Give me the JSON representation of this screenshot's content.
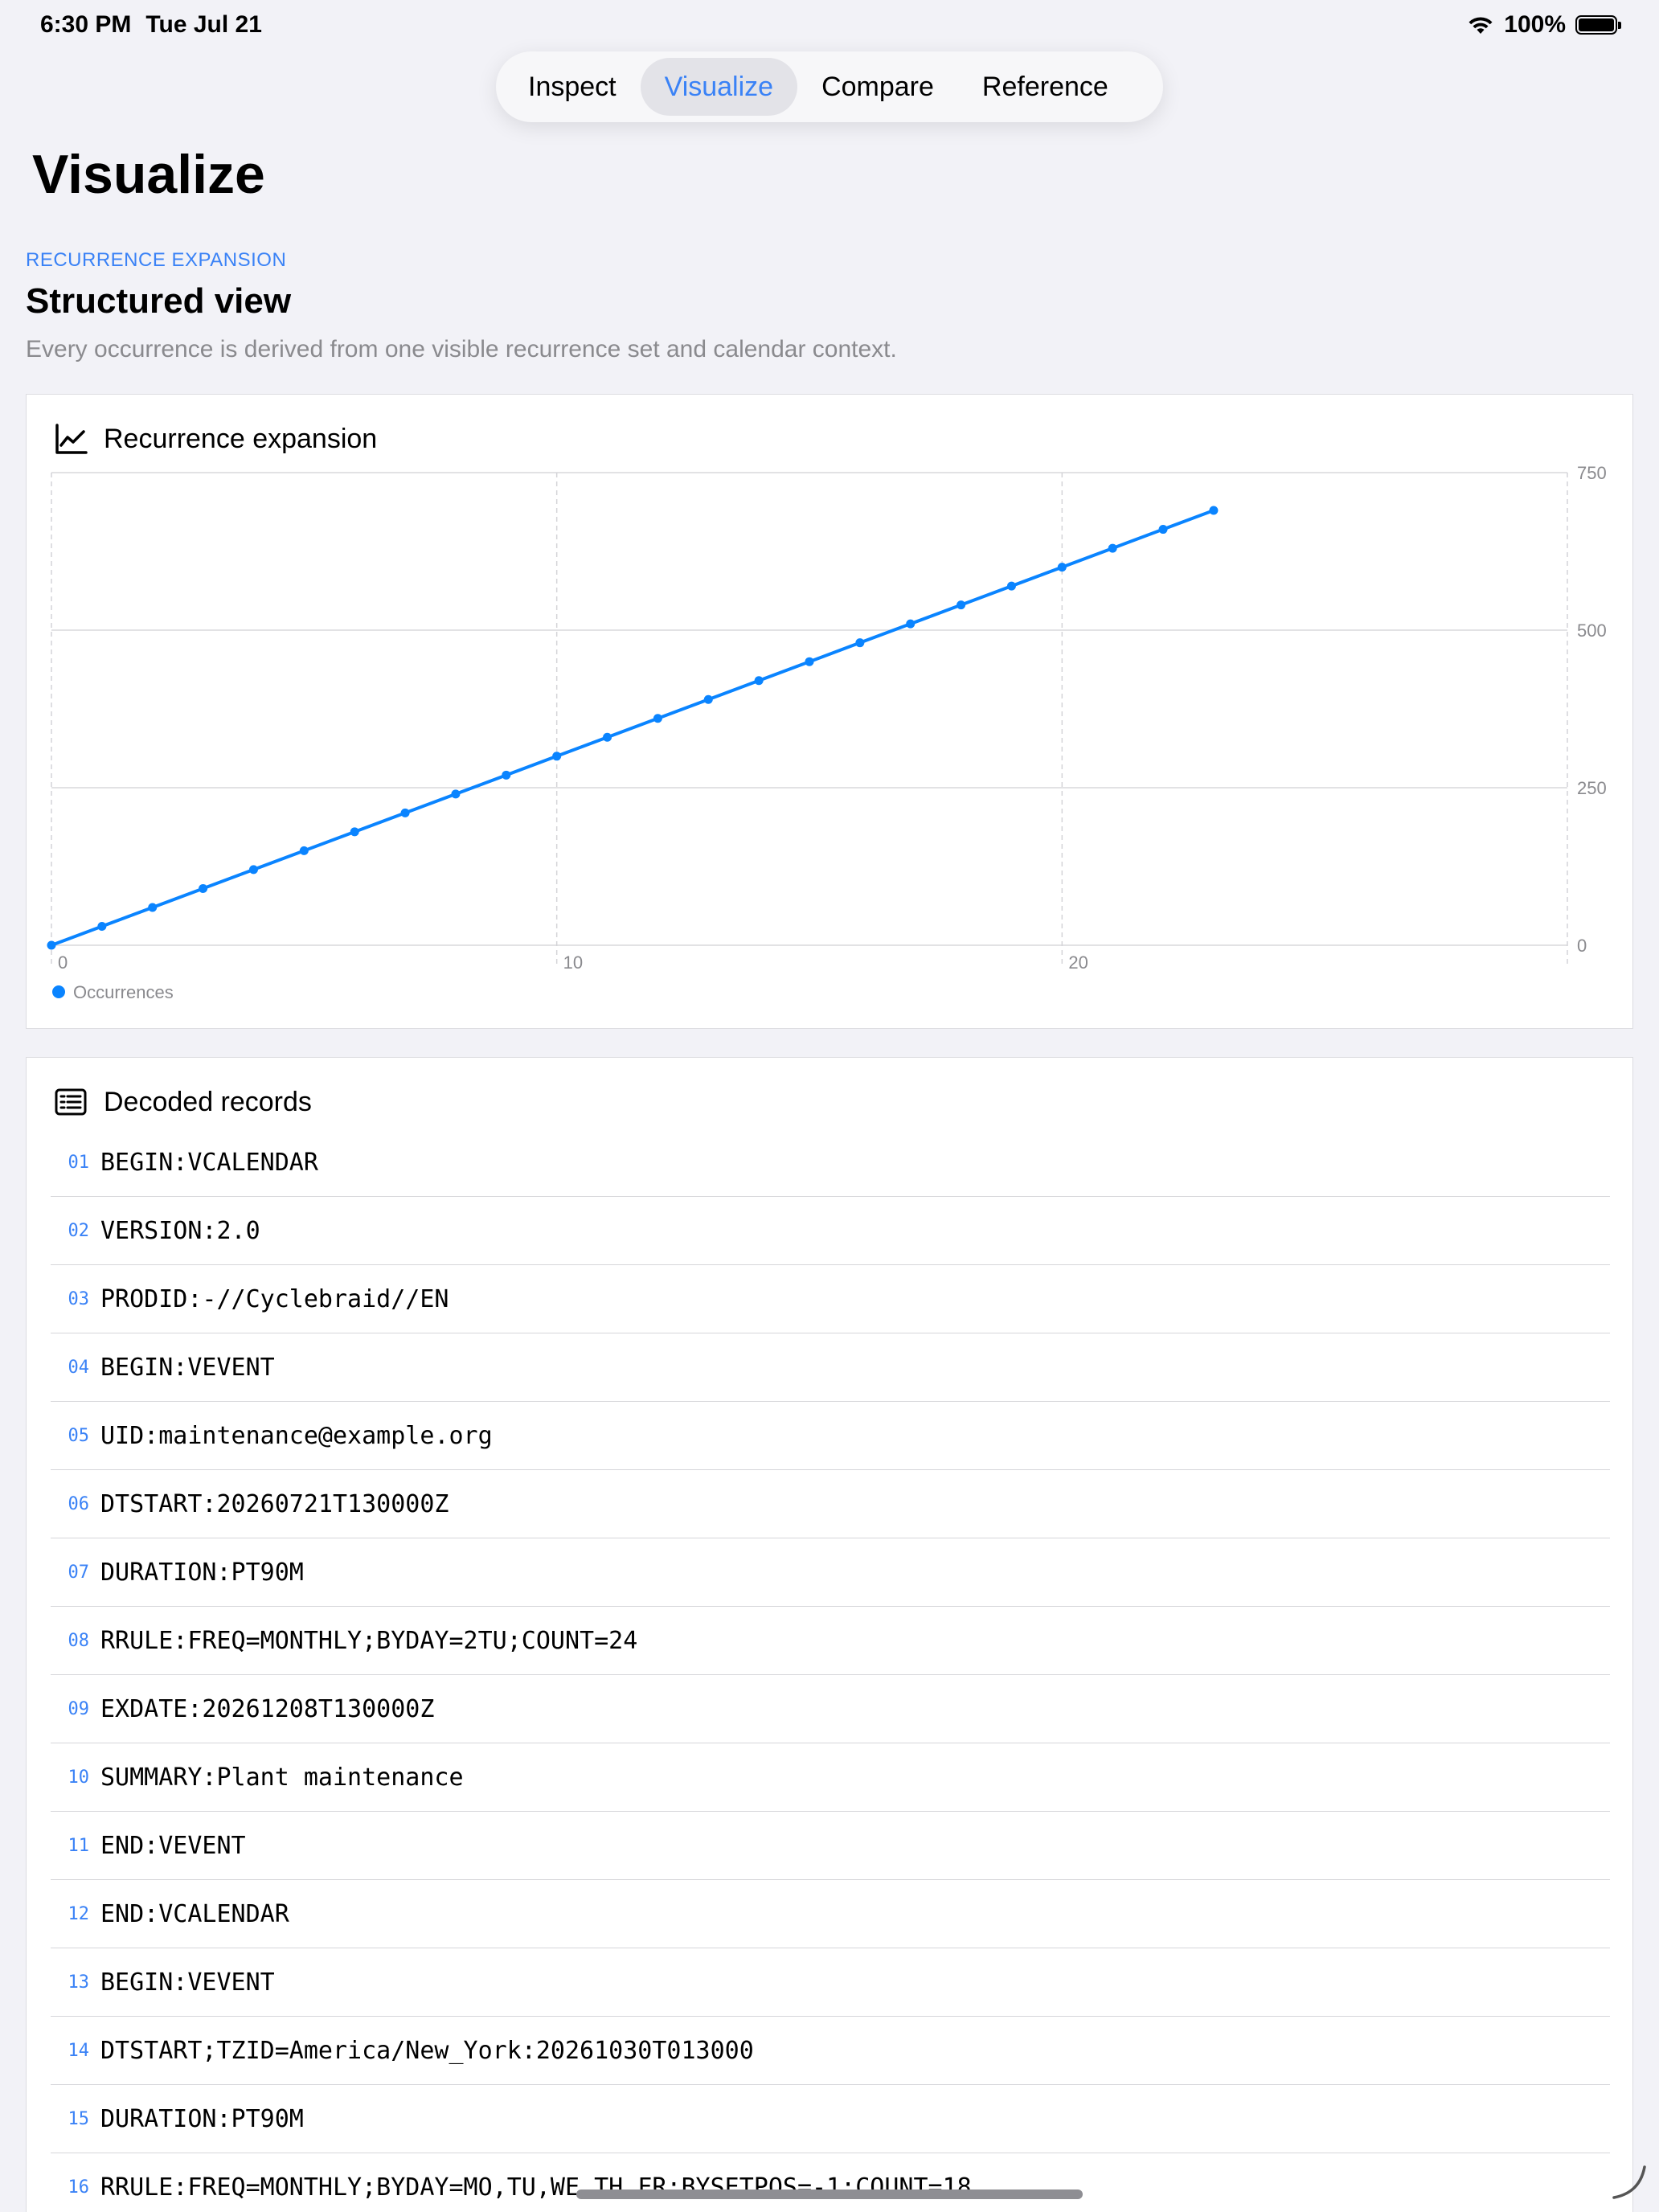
{
  "status": {
    "time": "6:30 PM",
    "date": "Tue Jul 21",
    "battery": "100%"
  },
  "tabs": [
    {
      "label": "Inspect",
      "active": false
    },
    {
      "label": "Visualize",
      "active": true
    },
    {
      "label": "Compare",
      "active": false
    },
    {
      "label": "Reference",
      "active": false
    }
  ],
  "page": {
    "title": "Visualize",
    "eyebrow": "RECURRENCE EXPANSION",
    "section_title": "Structured view",
    "section_subtitle": "Every occurrence is derived from one visible recurrence set and calendar context."
  },
  "chart_card": {
    "title": "Recurrence expansion",
    "icon": "line-chart-icon"
  },
  "chart_data": {
    "type": "line",
    "title": "Recurrence expansion",
    "xlabel": "",
    "ylabel": "",
    "x": [
      0,
      1,
      2,
      3,
      4,
      5,
      6,
      7,
      8,
      9,
      10,
      11,
      12,
      13,
      14,
      15,
      16,
      17,
      18,
      19,
      20,
      21,
      22,
      23
    ],
    "series": [
      {
        "name": "Occurrences",
        "color": "#0a84ff",
        "values": [
          0,
          30,
          60,
          90,
          120,
          150,
          180,
          210,
          240,
          270,
          300,
          330,
          360,
          390,
          420,
          450,
          480,
          510,
          540,
          570,
          600,
          630,
          660,
          690
        ]
      }
    ],
    "xlim": [
      0,
      30
    ],
    "ylim": [
      0,
      750
    ],
    "x_ticks": [
      "0",
      "10",
      "20"
    ],
    "y_ticks": [
      "0",
      "250",
      "500",
      "750"
    ],
    "y_axis_side": "right",
    "grid": true,
    "legend_placement": "bottom-left"
  },
  "records_card": {
    "title": "Decoded records",
    "icon": "list-document-icon",
    "rows": [
      {
        "num": "01",
        "text": "BEGIN:VCALENDAR"
      },
      {
        "num": "02",
        "text": "VERSION:2.0"
      },
      {
        "num": "03",
        "text": "PRODID:-//Cyclebraid//EN"
      },
      {
        "num": "04",
        "text": "BEGIN:VEVENT"
      },
      {
        "num": "05",
        "text": "UID:maintenance@example.org"
      },
      {
        "num": "06",
        "text": "DTSTART:20260721T130000Z"
      },
      {
        "num": "07",
        "text": "DURATION:PT90M"
      },
      {
        "num": "08",
        "text": "RRULE:FREQ=MONTHLY;BYDAY=2TU;COUNT=24"
      },
      {
        "num": "09",
        "text": "EXDATE:20261208T130000Z"
      },
      {
        "num": "10",
        "text": "SUMMARY:Plant maintenance"
      },
      {
        "num": "11",
        "text": "END:VEVENT"
      },
      {
        "num": "12",
        "text": "END:VCALENDAR"
      },
      {
        "num": "13",
        "text": "BEGIN:VEVENT"
      },
      {
        "num": "14",
        "text": "DTSTART;TZID=America/New_York:20261030T013000"
      },
      {
        "num": "15",
        "text": "DURATION:PT90M"
      },
      {
        "num": "16",
        "text": "RRULE:FREQ=MONTHLY;BYDAY=MO,TU,WE,TH,FR;BYSETPOS=-1;COUNT=18"
      }
    ]
  }
}
